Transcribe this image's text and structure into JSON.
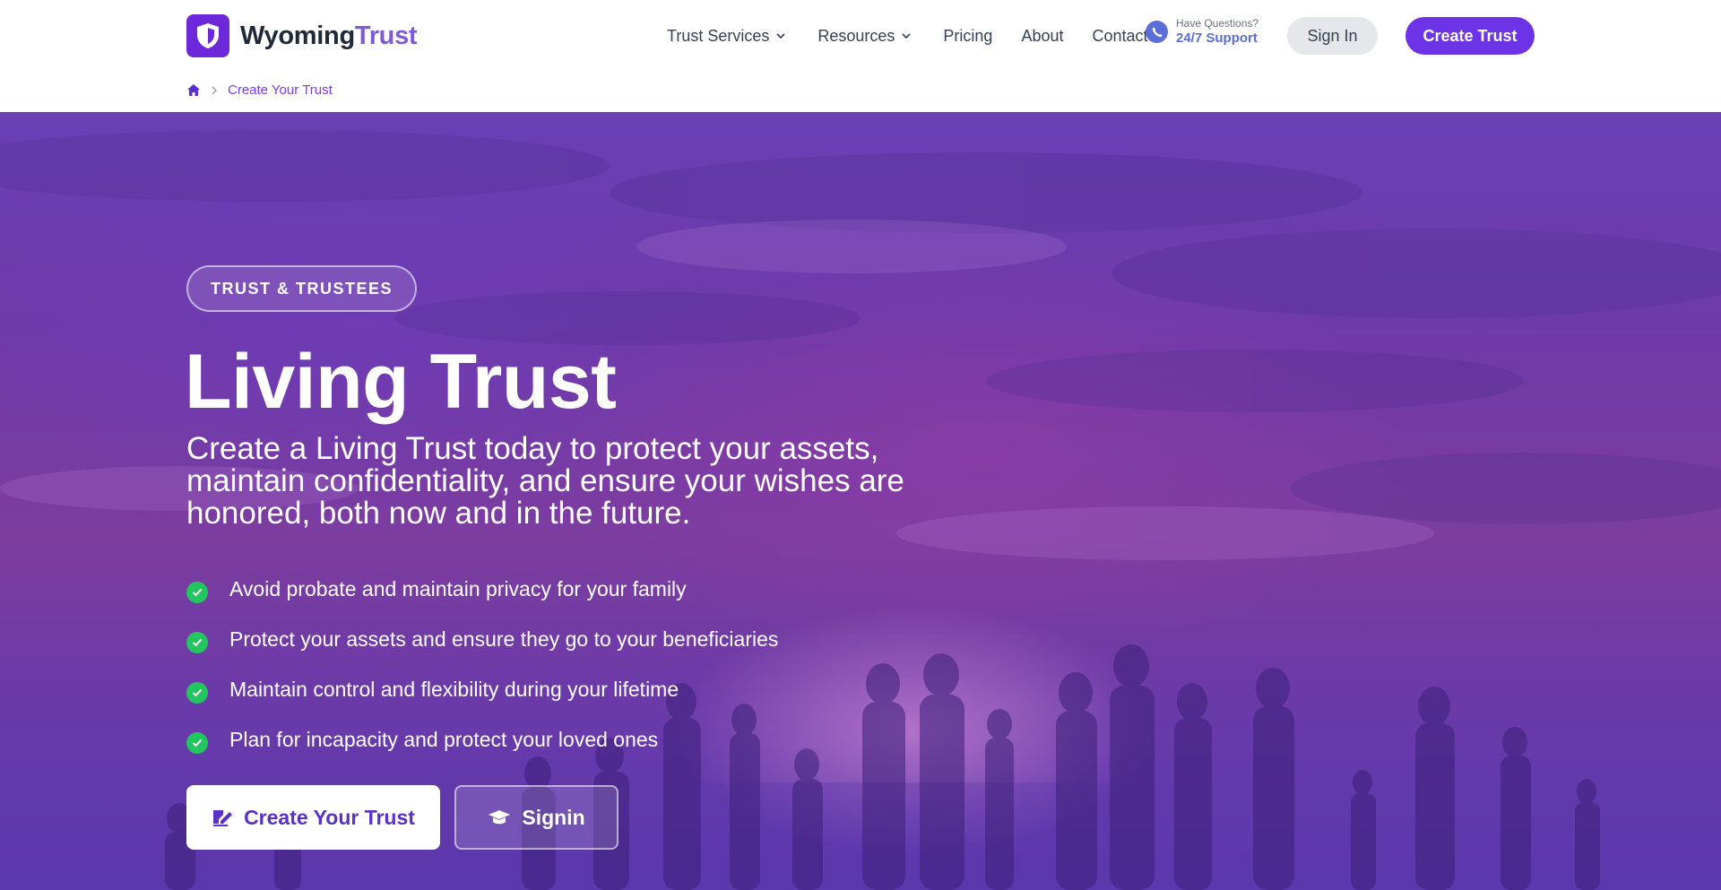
{
  "brand": {
    "name_part1": "Wyoming",
    "name_part2": "Trust"
  },
  "nav": {
    "items": [
      {
        "label": "Trust Services",
        "dropdown": true
      },
      {
        "label": "Resources",
        "dropdown": true
      },
      {
        "label": "Pricing",
        "dropdown": false
      },
      {
        "label": "About",
        "dropdown": false
      },
      {
        "label": "Contact",
        "dropdown": false
      }
    ]
  },
  "support": {
    "small": "Have Questions?",
    "big": "24/7 Support"
  },
  "header_buttons": {
    "signin": "Sign In",
    "create": "Create Trust"
  },
  "breadcrumb": {
    "home_icon": "home-icon",
    "current": "Create Your Trust"
  },
  "hero": {
    "pill": "TRUST & TRUSTEES",
    "title": "Living Trust",
    "subtitle": "Create a Living Trust today to protect your assets, maintain confidentiality, and ensure your wishes are honored, both now and in the future.",
    "features": [
      "Avoid probate and maintain privacy for your family",
      "Protect your assets and ensure they go to your beneficiaries",
      "Maintain control and flexibility during your lifetime",
      "Plan for incapacity and protect your loved ones"
    ],
    "cta_primary": "Create Your Trust",
    "cta_secondary": "Signin"
  },
  "colors": {
    "accent": "#6d33e6",
    "brand_light": "#7c5cd6",
    "support_blue": "#5b6fd8",
    "check_green": "#22c55e"
  }
}
